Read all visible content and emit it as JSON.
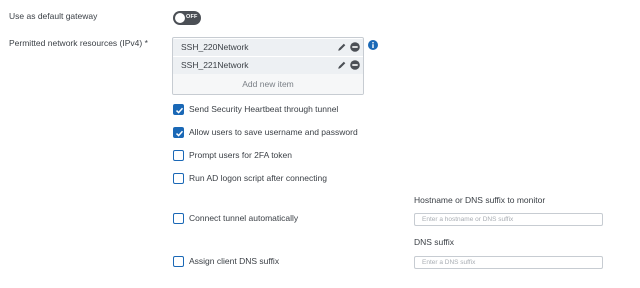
{
  "default_gateway": {
    "label": "Use as default gateway",
    "toggle_text": "OFF"
  },
  "permitted_resources": {
    "label": "Permitted network resources (IPv4) *",
    "items": [
      {
        "name": "SSH_220Network"
      },
      {
        "name": "SSH_221Network"
      }
    ],
    "add_label": "Add new item"
  },
  "options": [
    {
      "label": "Send Security Heartbeat through tunnel",
      "checked": true
    },
    {
      "label": "Allow users to save username and password",
      "checked": true
    },
    {
      "label": "Prompt users for 2FA token",
      "checked": false
    },
    {
      "label": "Run AD logon script after connecting",
      "checked": false
    },
    {
      "label": "Connect tunnel automatically",
      "checked": false
    },
    {
      "label": "Assign client DNS suffix",
      "checked": false
    }
  ],
  "hostname_monitor": {
    "label": "Hostname or DNS suffix to monitor",
    "placeholder": "Enter a hostname or DNS suffix",
    "value": ""
  },
  "dns_suffix": {
    "label": "DNS suffix",
    "placeholder": "Enter a DNS suffix",
    "value": ""
  },
  "colors": {
    "accent": "#1a68b6",
    "toggle_off": "#4b4f55",
    "item_bg": "#edf0f3",
    "border": "#c7ccd2"
  },
  "icons": {
    "edit": "pencil-icon",
    "remove": "minus-circle-icon",
    "info": "info-icon",
    "check": "checkmark-icon"
  }
}
